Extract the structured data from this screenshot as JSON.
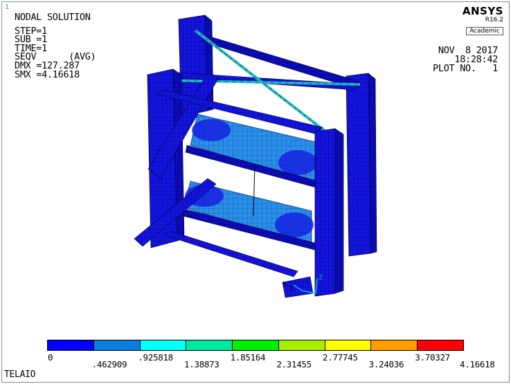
{
  "window": {
    "number": "1"
  },
  "header": {
    "title": "NODAL SOLUTION",
    "lines": [
      "STEP=1",
      "SUB =1",
      "TIME=1",
      "SEQV      (AVG)",
      "DMX =127.287",
      "SMX =4.16618"
    ]
  },
  "brand": {
    "name": "ANSYS",
    "version": "R16.2",
    "edition": "Academic"
  },
  "datetime": {
    "date": "NOV  8 2017",
    "time": "18:28:42",
    "plot": "PLOT NO.   1"
  },
  "triad": {
    "x": "X",
    "y": "Y",
    "z": "Z"
  },
  "legend": {
    "colors": [
      "#0000ff",
      "#0d7be0",
      "#00ffff",
      "#00e8a0",
      "#00ee00",
      "#a8ee00",
      "#ffff00",
      "#ff9c00",
      "#ff0000"
    ],
    "labels": [
      "0",
      ".462909",
      ".925818",
      "1.38873",
      "1.85164",
      "2.31455",
      "2.77745",
      "3.24036",
      "3.70327",
      "4.16618"
    ]
  },
  "jobname": "TELAIO"
}
